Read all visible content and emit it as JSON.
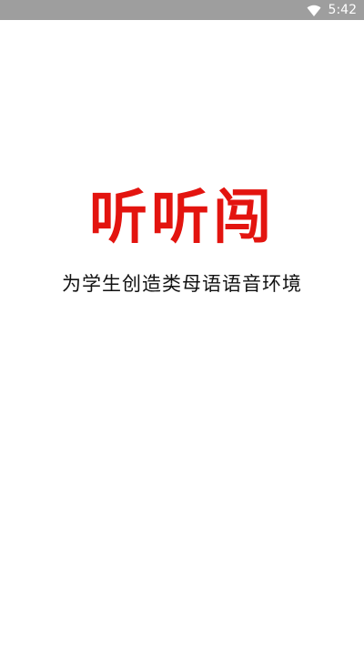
{
  "status_bar": {
    "time": "5:42",
    "wifi_icon": "wifi-icon"
  },
  "splash": {
    "app_name": "听听闯",
    "slogan": "为学生创造类母语语音环境",
    "accent_color": "#e3140f"
  }
}
